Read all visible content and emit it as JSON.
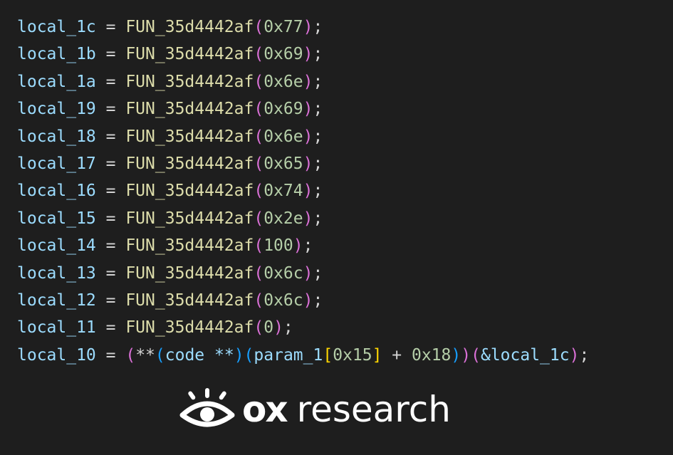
{
  "code": {
    "lines": [
      {
        "var": "local_1c",
        "eq": " = ",
        "fn": "FUN_35d4442af",
        "open": "(",
        "arg": "0x77",
        "close": ")",
        "end": ";"
      },
      {
        "var": "local_1b",
        "eq": " = ",
        "fn": "FUN_35d4442af",
        "open": "(",
        "arg": "0x69",
        "close": ")",
        "end": ";"
      },
      {
        "var": "local_1a",
        "eq": " = ",
        "fn": "FUN_35d4442af",
        "open": "(",
        "arg": "0x6e",
        "close": ")",
        "end": ";"
      },
      {
        "var": "local_19",
        "eq": " = ",
        "fn": "FUN_35d4442af",
        "open": "(",
        "arg": "0x69",
        "close": ")",
        "end": ";"
      },
      {
        "var": "local_18",
        "eq": " = ",
        "fn": "FUN_35d4442af",
        "open": "(",
        "arg": "0x6e",
        "close": ")",
        "end": ";"
      },
      {
        "var": "local_17",
        "eq": " = ",
        "fn": "FUN_35d4442af",
        "open": "(",
        "arg": "0x65",
        "close": ")",
        "end": ";"
      },
      {
        "var": "local_16",
        "eq": " = ",
        "fn": "FUN_35d4442af",
        "open": "(",
        "arg": "0x74",
        "close": ")",
        "end": ";"
      },
      {
        "var": "local_15",
        "eq": " = ",
        "fn": "FUN_35d4442af",
        "open": "(",
        "arg": "0x2e",
        "close": ")",
        "end": ";"
      },
      {
        "var": "local_14",
        "eq": " = ",
        "fn": "FUN_35d4442af",
        "open": "(",
        "arg": "100",
        "close": ")",
        "end": ";"
      },
      {
        "var": "local_13",
        "eq": " = ",
        "fn": "FUN_35d4442af",
        "open": "(",
        "arg": "0x6c",
        "close": ")",
        "end": ";"
      },
      {
        "var": "local_12",
        "eq": " = ",
        "fn": "FUN_35d4442af",
        "open": "(",
        "arg": "0x6c",
        "close": ")",
        "end": ";"
      },
      {
        "var": "local_11",
        "eq": " = ",
        "fn": "FUN_35d4442af",
        "open": "(",
        "arg": "0",
        "close": ")",
        "end": ";"
      }
    ],
    "final": {
      "var": "local_10",
      "eq": " = ",
      "p_open1": "(",
      "deref1": "**",
      "p_open2": "(",
      "cast": "code **",
      "p_close2": ")",
      "p_open3": "(",
      "param": "param_1",
      "b_open": "[",
      "index": "0x15",
      "b_close": "]",
      "plus": " + ",
      "offset": "0x18",
      "p_close3": ")",
      "p_close1": ")",
      "p_open4": "(",
      "amp_ref": "&local_1c",
      "p_close4": ")",
      "end": ";"
    }
  },
  "brand": {
    "icon": "eye-icon",
    "ox": "ox",
    "research": "research"
  },
  "colors": {
    "background": "#1e1e1e",
    "variable": "#9cdcfe",
    "function": "#dcdcaa",
    "number": "#b5cea8",
    "paren_level1": "#da70d6",
    "paren_level2": "#179fff",
    "bracket_level3": "#ffd700",
    "brand": "#ffffff"
  }
}
